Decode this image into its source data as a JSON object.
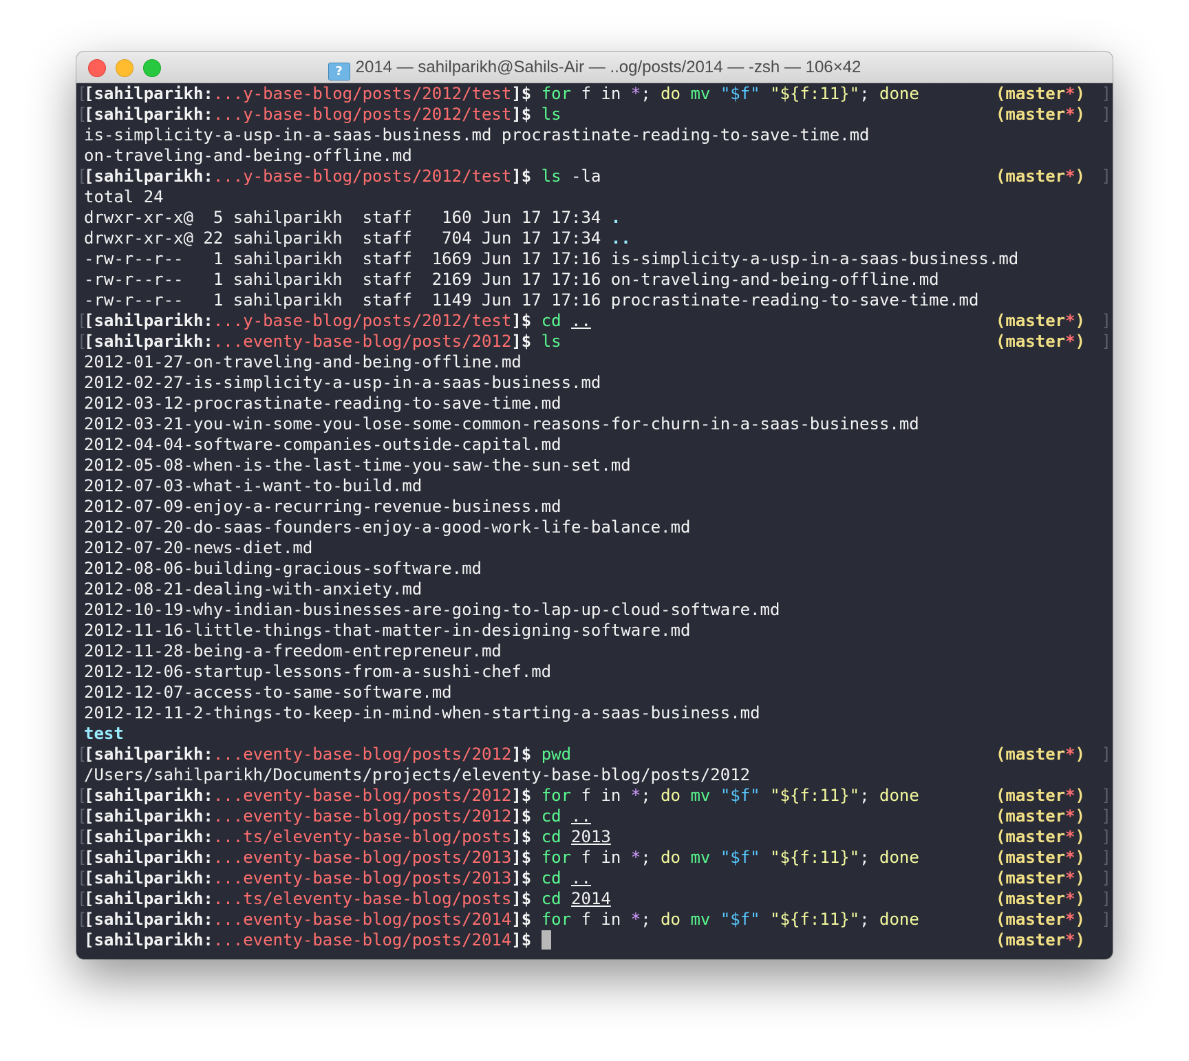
{
  "window": {
    "title": "2014 — sahilparikh@Sahils-Air — ..og/posts/2014 — -zsh — 106×42",
    "folder_glyph": "?"
  },
  "prompt": {
    "user": "sahilparikh:",
    "git": "master",
    "dirty": "*"
  },
  "terminal": {
    "p1": {
      "path": "...y-base-blog/posts/2012/test",
      "cmd": "for",
      "a1": " f in ",
      "glob": "*",
      "a2": "; ",
      "kw": "do",
      "mv": "mv",
      "v1": "\"$f\"",
      "v2": "\"${f:11}\"",
      "a3": "; ",
      "done": "done"
    },
    "p2": {
      "path": "...y-base-blog/posts/2012/test",
      "cmd": "ls"
    },
    "o1": "is-simplicity-a-usp-in-a-saas-business.md procrastinate-reading-to-save-time.md",
    "o2": "on-traveling-and-being-offline.md",
    "p3": {
      "path": "...y-base-blog/posts/2012/test",
      "cmd": "ls",
      "args": " -la"
    },
    "la": [
      "total 24",
      {
        "meta": "drwxr-xr-x@  5 sahilparikh  staff   160 Jun 17 17:34 ",
        "name": "."
      },
      {
        "meta": "drwxr-xr-x@ 22 sahilparikh  staff   704 Jun 17 17:34 ",
        "name": ".."
      },
      "-rw-r--r--   1 sahilparikh  staff  1669 Jun 17 17:16 is-simplicity-a-usp-in-a-saas-business.md",
      "-rw-r--r--   1 sahilparikh  staff  2169 Jun 17 17:16 on-traveling-and-being-offline.md",
      "-rw-r--r--   1 sahilparikh  staff  1149 Jun 17 17:16 procrastinate-reading-to-save-time.md"
    ],
    "p4": {
      "path": "...y-base-blog/posts/2012/test",
      "cmd": "cd",
      "arg": ".."
    },
    "p5": {
      "path": "...eventy-base-blog/posts/2012",
      "cmd": "ls"
    },
    "files": [
      "2012-01-27-on-traveling-and-being-offline.md",
      "2012-02-27-is-simplicity-a-usp-in-a-saas-business.md",
      "2012-03-12-procrastinate-reading-to-save-time.md",
      "2012-03-21-you-win-some-you-lose-some-common-reasons-for-churn-in-a-saas-business.md",
      "2012-04-04-software-companies-outside-capital.md",
      "2012-05-08-when-is-the-last-time-you-saw-the-sun-set.md",
      "2012-07-03-what-i-want-to-build.md",
      "2012-07-09-enjoy-a-recurring-revenue-business.md",
      "2012-07-20-do-saas-founders-enjoy-a-good-work-life-balance.md",
      "2012-07-20-news-diet.md",
      "2012-08-06-building-gracious-software.md",
      "2012-08-21-dealing-with-anxiety.md",
      "2012-10-19-why-indian-businesses-are-going-to-lap-up-cloud-software.md",
      "2012-11-16-little-things-that-matter-in-designing-software.md",
      "2012-11-28-being-a-freedom-entrepreneur.md",
      "2012-12-06-startup-lessons-from-a-sushi-chef.md",
      "2012-12-07-access-to-same-software.md",
      "2012-12-11-2-things-to-keep-in-mind-when-starting-a-saas-business.md"
    ],
    "testdir": "test",
    "p6": {
      "path": "...eventy-base-blog/posts/2012",
      "cmd": "pwd"
    },
    "pwd_out": "/Users/sahilparikh/Documents/projects/eleventy-base-blog/posts/2012",
    "p7": {
      "path": "...eventy-base-blog/posts/2012",
      "cmd": "for",
      "a1": " f in ",
      "glob": "*",
      "a2": "; ",
      "kw": "do",
      "mv": "mv",
      "v1": "\"$f\"",
      "v2": "\"${f:11}\"",
      "a3": "; ",
      "done": "done"
    },
    "p8": {
      "path": "...eventy-base-blog/posts/2012",
      "cmd": "cd",
      "arg": ".."
    },
    "p9": {
      "path": "...ts/eleventy-base-blog/posts",
      "cmd": "cd",
      "arg": "2013"
    },
    "p10": {
      "path": "...eventy-base-blog/posts/2013",
      "cmd": "for",
      "a1": " f in ",
      "glob": "*",
      "a2": "; ",
      "kw": "do",
      "mv": "mv",
      "v1": "\"$f\"",
      "v2": "\"${f:11}\"",
      "a3": "; ",
      "done": "done"
    },
    "p11": {
      "path": "...eventy-base-blog/posts/2013",
      "cmd": "cd",
      "arg": ".."
    },
    "p12": {
      "path": "...ts/eleventy-base-blog/posts",
      "cmd": "cd",
      "arg": "2014"
    },
    "p13": {
      "path": "...eventy-base-blog/posts/2014",
      "cmd": "for",
      "a1": " f in ",
      "glob": "*",
      "a2": "; ",
      "kw": "do",
      "mv": "mv",
      "v1": "\"$f\"",
      "v2": "\"${f:11}\"",
      "a3": "; ",
      "done": "done"
    },
    "p14": {
      "path": "...eventy-base-blog/posts/2014"
    }
  }
}
